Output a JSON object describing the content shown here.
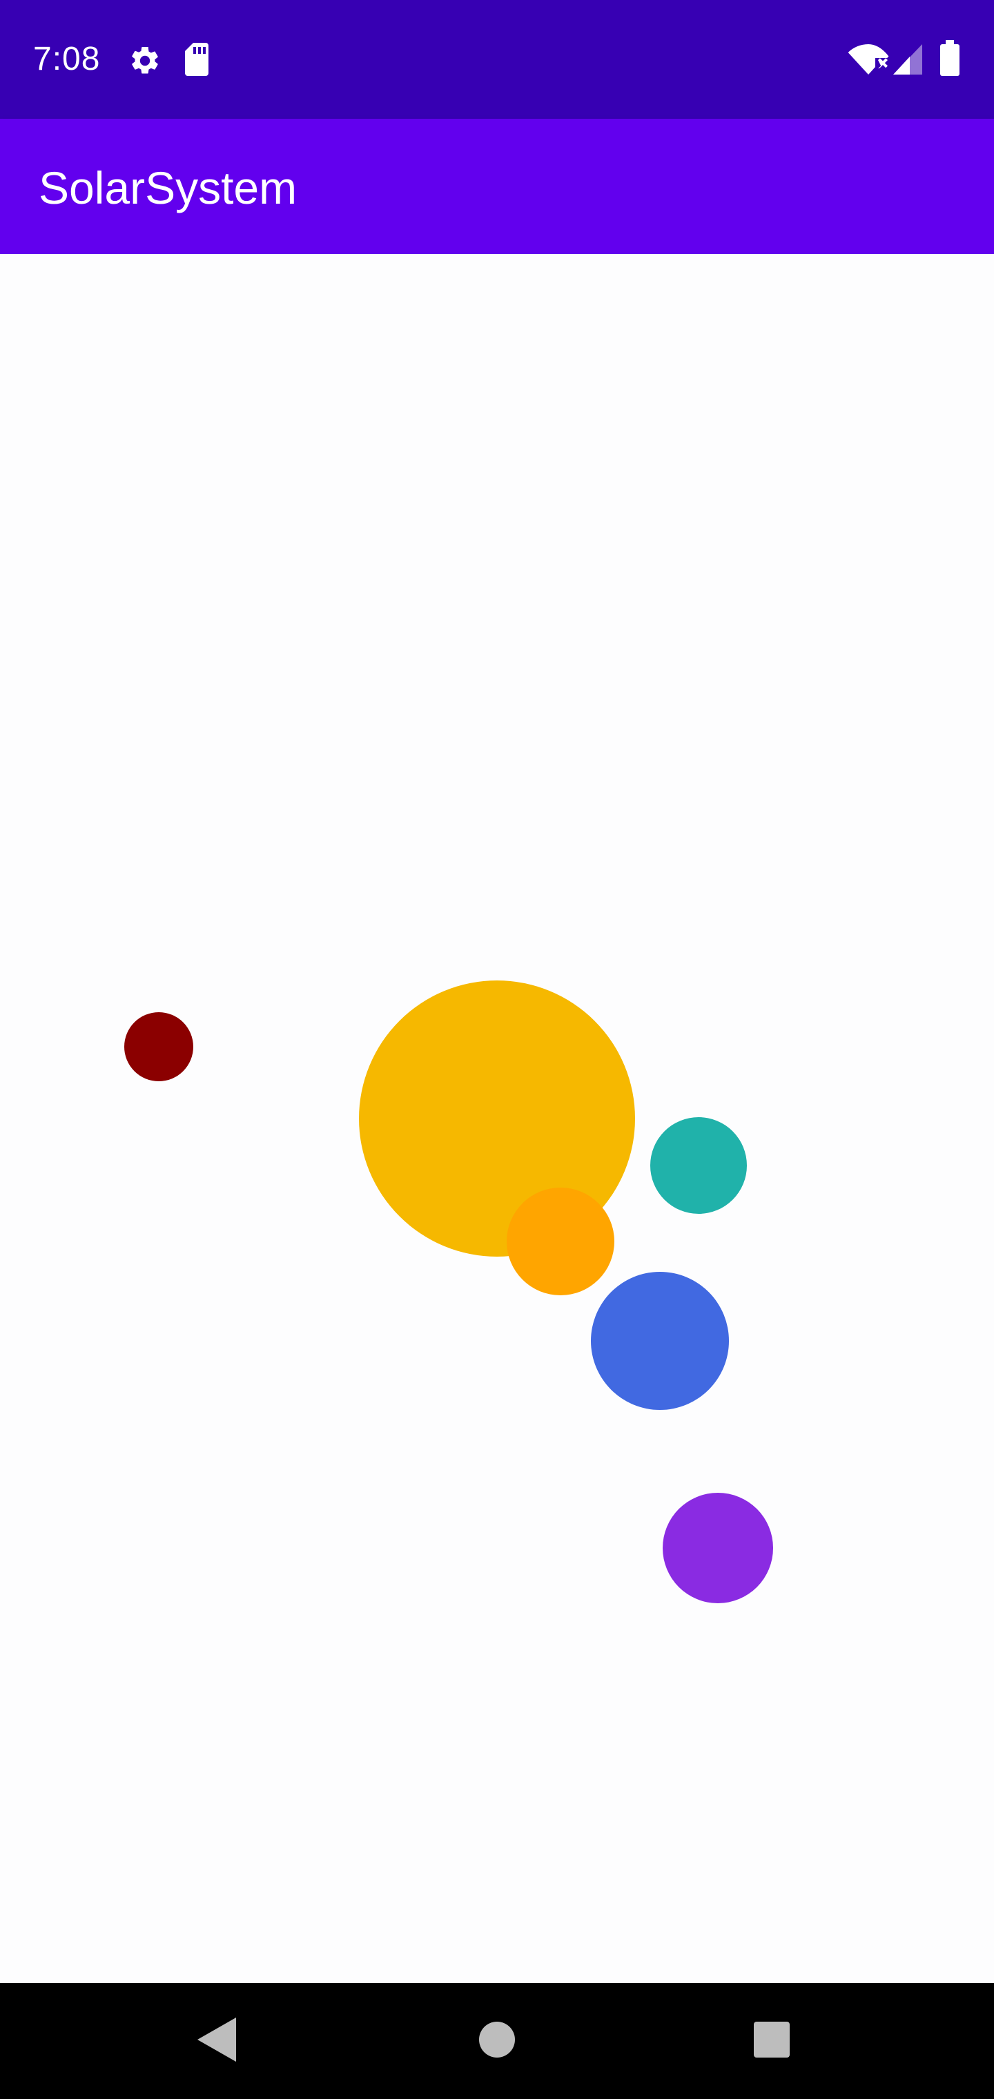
{
  "status_bar": {
    "time": "7:08",
    "background": "#3700b3",
    "icons": [
      "settings-gear-icon",
      "sd-card-icon",
      "wifi-off-icon",
      "cell-signal-icon",
      "battery-icon"
    ]
  },
  "app_bar": {
    "title": "SolarSystem",
    "background": "#6200ee"
  },
  "solar_system": {
    "background": "#fdfdfe",
    "bodies": [
      {
        "name": "sun",
        "color": "#f6b800"
      },
      {
        "name": "orange-planet",
        "color": "#ffa500"
      },
      {
        "name": "dark-red-planet",
        "color": "#8b0000"
      },
      {
        "name": "teal-planet",
        "color": "#20b2aa"
      },
      {
        "name": "blue-planet",
        "color": "#4169e1"
      },
      {
        "name": "purple-planet",
        "color": "#8a2be2"
      }
    ]
  },
  "nav_bar": {
    "background": "#000000",
    "icons": [
      "back-icon",
      "home-icon",
      "recents-icon"
    ]
  }
}
